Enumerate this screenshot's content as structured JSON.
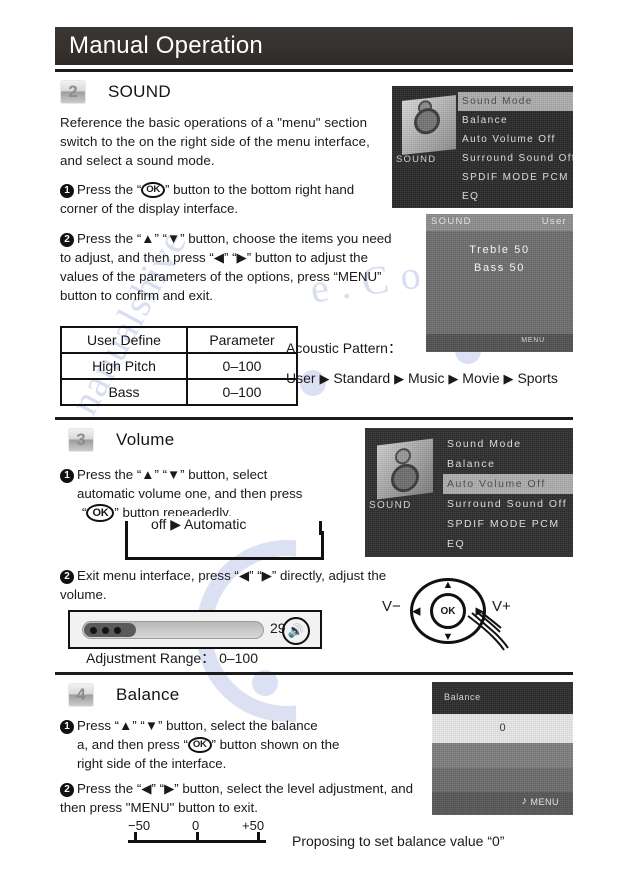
{
  "header": {
    "title": "Manual Operation"
  },
  "sections": {
    "sound": {
      "number": "2",
      "title": "SOUND",
      "intro": "Reference the basic operations of a \"menu\" section switch to the on the right side of the menu interface, and select a sound mode.",
      "step1": "Press the  “OK”  button to the bottom right hand corner of the display interface.",
      "step1_pre": "Press the  “",
      "step1_ok": "OK",
      "step1_post": "”  button to the bottom right hand corner of the display interface.",
      "step2": "Press the  “▲”  “▼”  button, choose the items you need to adjust, and then press “◀”  “▶”  button to adjust the values of the parameters of the options, press  “MENU” button to confirm and exit.",
      "table": {
        "headers": [
          "User Define",
          "Parameter"
        ],
        "rows": [
          [
            "High Pitch",
            "0–100"
          ],
          [
            "Bass",
            "0–100"
          ]
        ]
      },
      "acoustic": {
        "label": "Acoustic Pattern：",
        "chain": [
          "User",
          "Standard",
          "Music",
          "Movie",
          "Sports"
        ],
        "arrow": "▶"
      }
    },
    "volume": {
      "number": "3",
      "title": "Volume",
      "step1": "Press the  “▲”  “▼” button, select automatic volume one, and then press “OK” button repeadedly.",
      "step1_l1": "Press the  “▲”   “▼”  button, select",
      "step1_l2": "automatic volume one, and then press",
      "step1_l3_pre": "“",
      "step1_l3_ok": "OK",
      "step1_l3_post": "”  button repeadedly.",
      "cycle": "off ▶ Automatic",
      "step2": "Exit menu interface, press  “◀”   “▶” directly, adjust the volume.",
      "volume_value": "29",
      "volume_icon": "speaker-icon",
      "adjustment_range": "Adjustment Range： 0–100",
      "remote": {
        "v_minus": "V−",
        "v_plus": "V+",
        "ok": "OK",
        "up": "▲",
        "down": "▼",
        "left": "◀",
        "right": "▶"
      }
    },
    "balance": {
      "number": "4",
      "title": "Balance",
      "step1_l1": "Press “▲”   “▼”  button, select the balance",
      "step1_l2_pre": "a, and then press  “",
      "step1_l2_ok": "OK",
      "step1_l2_post": "”   button shown on the",
      "step1_l3": "right side of the interface.",
      "step2": "Press the  “◀”   “▶”  button, select the level adjustment, and then press \"MENU\" button to exit.",
      "scale": {
        "min": "−50",
        "mid": "0",
        "max": "+50"
      },
      "proposing": "Proposing to set balance value  “0”"
    }
  },
  "tv_screens": {
    "sound_menu": {
      "label": "SOUND",
      "items": [
        {
          "text": "Sound Mode",
          "selected": true
        },
        {
          "text": "Balance",
          "selected": false
        },
        {
          "text": "Auto Volume Off",
          "selected": false
        },
        {
          "text": "Surround Sound Off",
          "selected": false
        },
        {
          "text": "SPDIF MODE PCM",
          "selected": false
        },
        {
          "text": "EQ",
          "selected": false
        }
      ]
    },
    "user_eq": {
      "left_label": "SOUND",
      "right_label": "User",
      "treble": "Treble 50",
      "bass": "Bass 50",
      "menu": "MENU"
    },
    "volume_menu": {
      "label": "SOUND",
      "items": [
        {
          "text": "Sound Mode",
          "selected": false
        },
        {
          "text": "Balance",
          "selected": false
        },
        {
          "text": "Auto Volume Off",
          "selected": true
        },
        {
          "text": "Surround Sound Off",
          "selected": false
        },
        {
          "text": "SPDIF MODE PCM",
          "selected": false
        },
        {
          "text": "EQ",
          "selected": false
        }
      ]
    },
    "balance_screen": {
      "title": "Balance",
      "value": "0",
      "menu": "MENU"
    }
  },
  "watermark": {
    "line1": "e . C o m",
    "line2": "nanualshive"
  }
}
